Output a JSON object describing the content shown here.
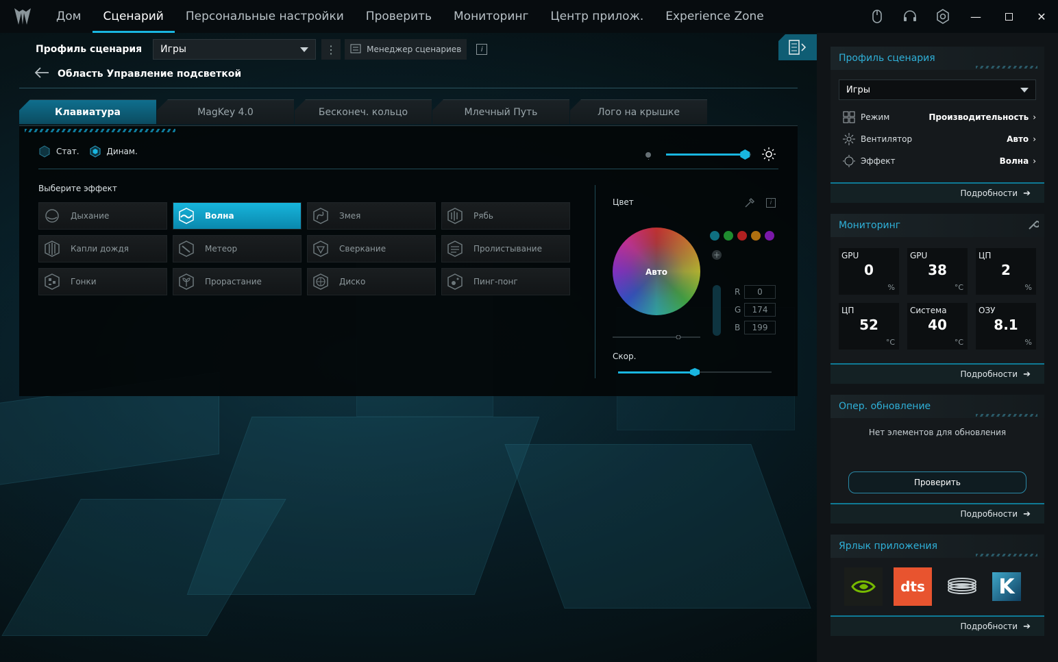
{
  "nav": {
    "tabs": [
      "Дом",
      "Сценарий",
      "Персональные настройки",
      "Проверить",
      "Мониторинг",
      "Центр прилож.",
      "Experience Zone"
    ],
    "active": 1
  },
  "toolbar": {
    "profile_label": "Профиль сценария",
    "profile_value": "Игры",
    "manager_label": "Менеджер сценариев",
    "info_glyph": "i"
  },
  "breadcrumb": {
    "title": "Область Управление подсветкой"
  },
  "subtabs": [
    "Клавиатура",
    "MagKey 4.0",
    "Бесконеч. кольцо",
    "Млечный Путь",
    "Лого на крышке"
  ],
  "panel": {
    "mode_static": "Стат.",
    "mode_dynamic": "Динам.",
    "brightness_level": 0.93,
    "effects_title": "Выберите эффект",
    "effects": [
      {
        "label": "Дыхание",
        "icon": "breath-icon"
      },
      {
        "label": "Волна",
        "icon": "wave-icon",
        "active": true
      },
      {
        "label": "Змея",
        "icon": "snake-icon"
      },
      {
        "label": "Рябь",
        "icon": "ripple-icon"
      },
      {
        "label": "Капли дождя",
        "icon": "raindrop-icon"
      },
      {
        "label": "Метеор",
        "icon": "meteor-icon"
      },
      {
        "label": "Сверкание",
        "icon": "sparkle-icon"
      },
      {
        "label": "Пролистывание",
        "icon": "scroll-icon"
      },
      {
        "label": "Гонки",
        "icon": "race-flag-icon"
      },
      {
        "label": "Прорастание",
        "icon": "sprout-icon"
      },
      {
        "label": "Диско",
        "icon": "disco-icon"
      },
      {
        "label": "Пинг-понг",
        "icon": "pingpong-icon"
      }
    ],
    "color_title": "Цвет",
    "wheel_label": "Авто",
    "swatches": [
      "#0f6f80",
      "#1f8c2f",
      "#b02020",
      "#b07010",
      "#7a18a8"
    ],
    "rgb": {
      "r_label": "R",
      "g_label": "G",
      "b_label": "B",
      "r": "0",
      "g": "174",
      "b": "199"
    },
    "speed_title": "Скор.",
    "speed_level": 0.5
  },
  "sidebar": {
    "profile": {
      "title": "Профиль сценария",
      "select": "Игры",
      "rows": [
        {
          "key": "Режим",
          "value": "Производительность"
        },
        {
          "key": "Вентилятор",
          "value": "Авто"
        },
        {
          "key": "Эффект",
          "value": "Волна"
        }
      ],
      "more": "Подробности"
    },
    "monitoring": {
      "title": "Мониторинг",
      "tiles": [
        {
          "label": "GPU",
          "value": "0",
          "unit": "%"
        },
        {
          "label": "GPU",
          "value": "38",
          "unit": "°C"
        },
        {
          "label": "ЦП",
          "value": "2",
          "unit": "%"
        },
        {
          "label": "ЦП",
          "value": "52",
          "unit": "°C"
        },
        {
          "label": "Система",
          "value": "40",
          "unit": "°C"
        },
        {
          "label": "ОЗУ",
          "value": "8.1",
          "unit": "%"
        }
      ],
      "more": "Подробности"
    },
    "update": {
      "title": "Опер. обновление",
      "empty": "Нет элементов для обновления",
      "check": "Проверить",
      "more": "Подробности"
    },
    "shortcuts": {
      "title": "Ярлык приложения",
      "apps": [
        {
          "icon": "nvidia-icon",
          "label": ""
        },
        {
          "icon": "dts-icon",
          "label": "dts"
        },
        {
          "icon": "coil-icon",
          "label": ""
        },
        {
          "icon": "killer-icon",
          "label": "K"
        }
      ],
      "more": "Подробности"
    }
  },
  "colors": {
    "accent": "#19b6e0",
    "active_tab": "#0f6f8e",
    "header_text": "#2fb0d8"
  }
}
